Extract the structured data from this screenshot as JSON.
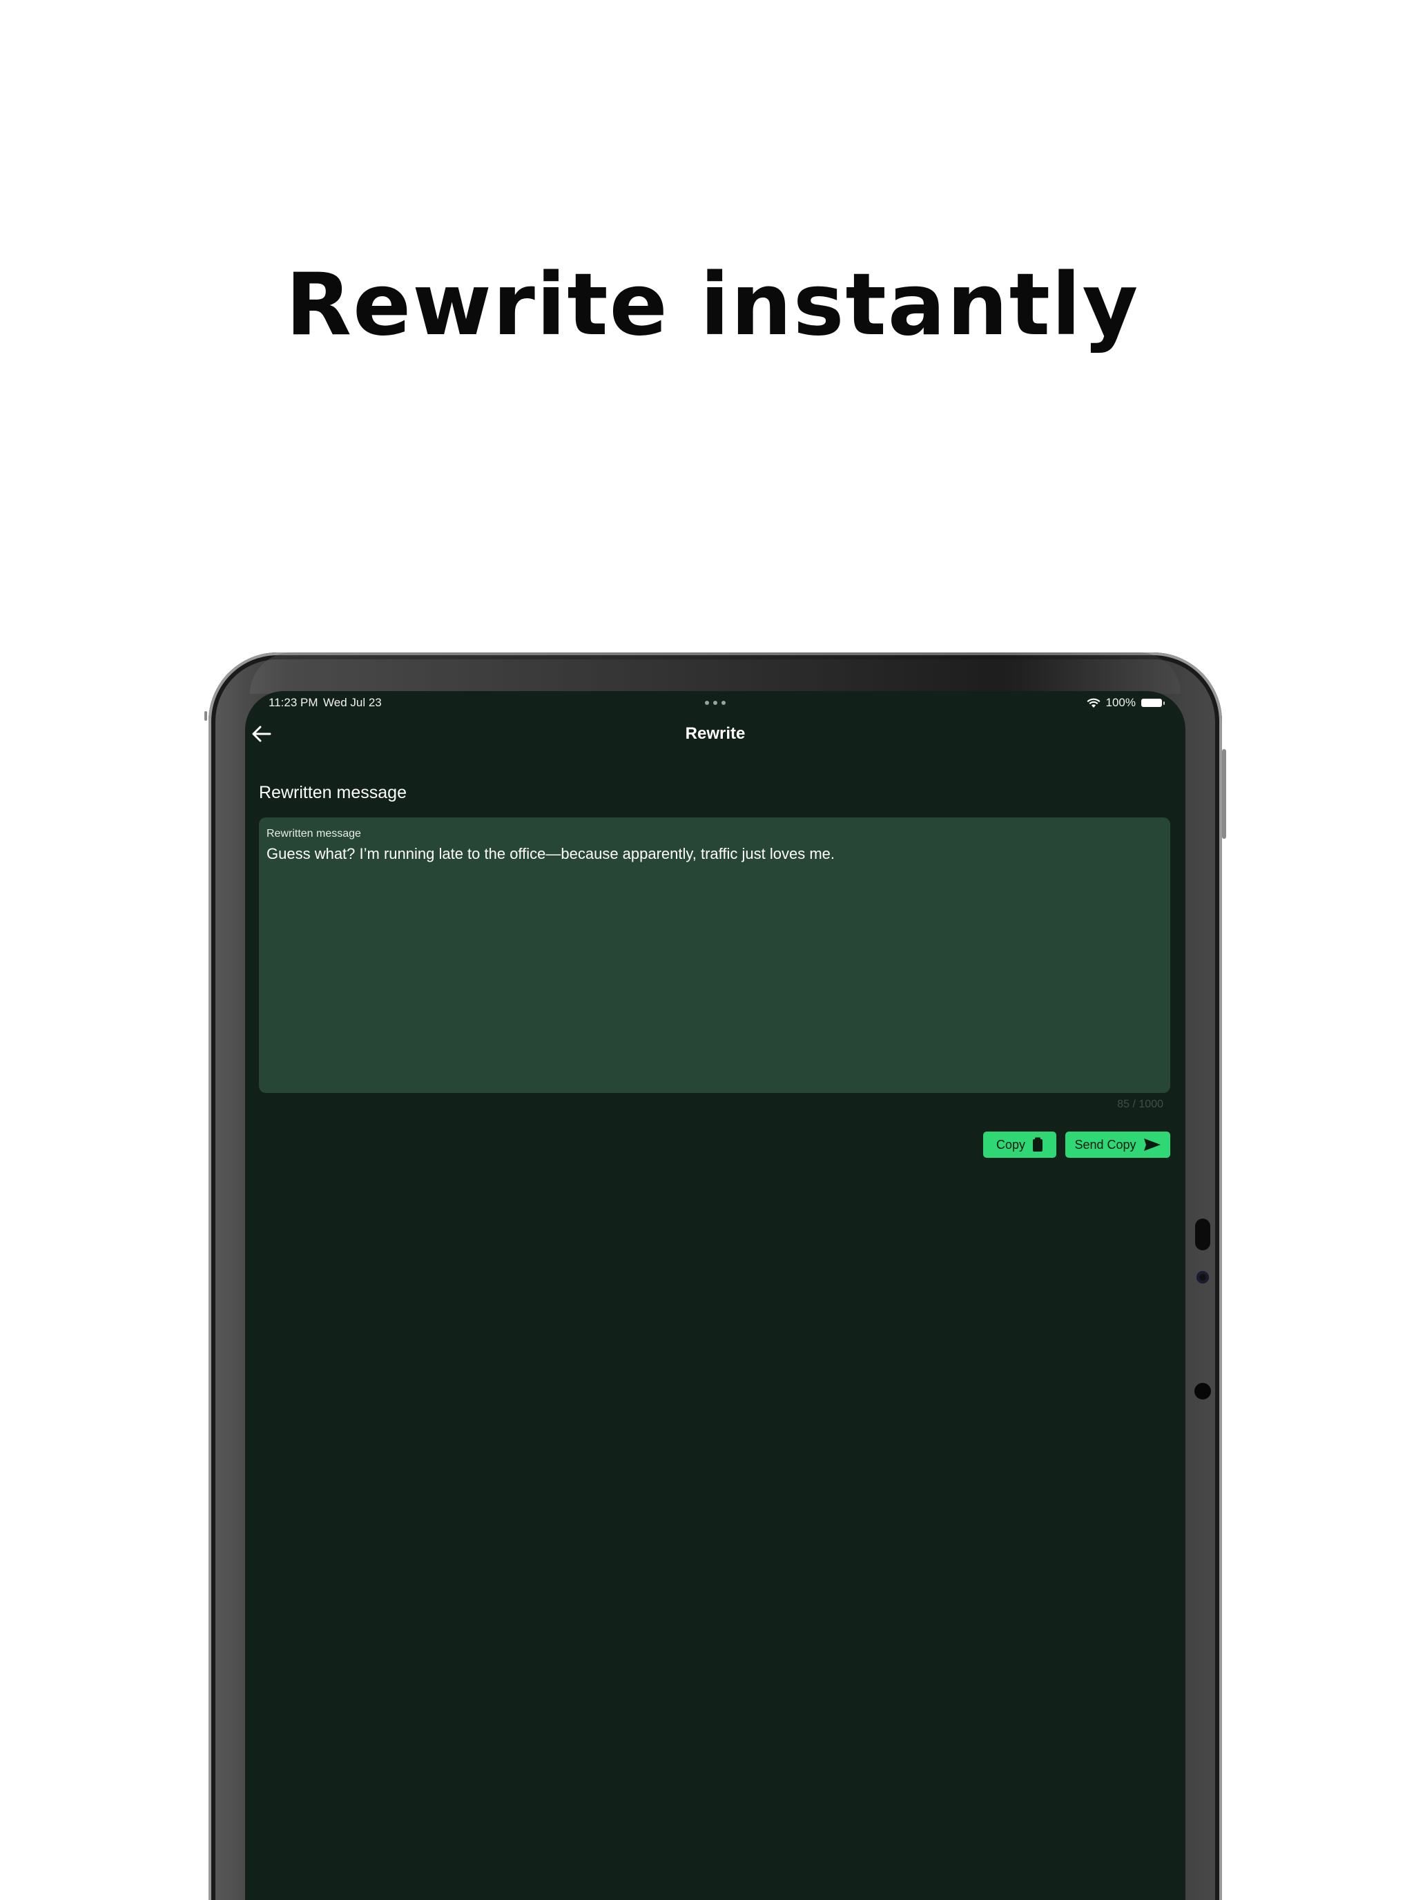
{
  "headline": "Rewrite instantly",
  "status_bar": {
    "time": "11:23 PM",
    "date": "Wed Jul 23",
    "battery": "100%"
  },
  "nav": {
    "title": "Rewrite",
    "back_icon": "arrow-left-icon"
  },
  "section": {
    "title": "Rewritten message"
  },
  "message_field": {
    "label": "Rewritten message",
    "value": "Guess what? I’m running late to the office—because apparently, traffic just loves me.",
    "char_count": "85 / 1000"
  },
  "actions": {
    "copy_label": "Copy",
    "copy_icon": "clipboard-icon",
    "send_copy_label": "Send Copy",
    "send_icon": "send-icon"
  },
  "colors": {
    "screen_bg": "#112018",
    "field_bg": "#284636",
    "accent": "#2fd874"
  }
}
